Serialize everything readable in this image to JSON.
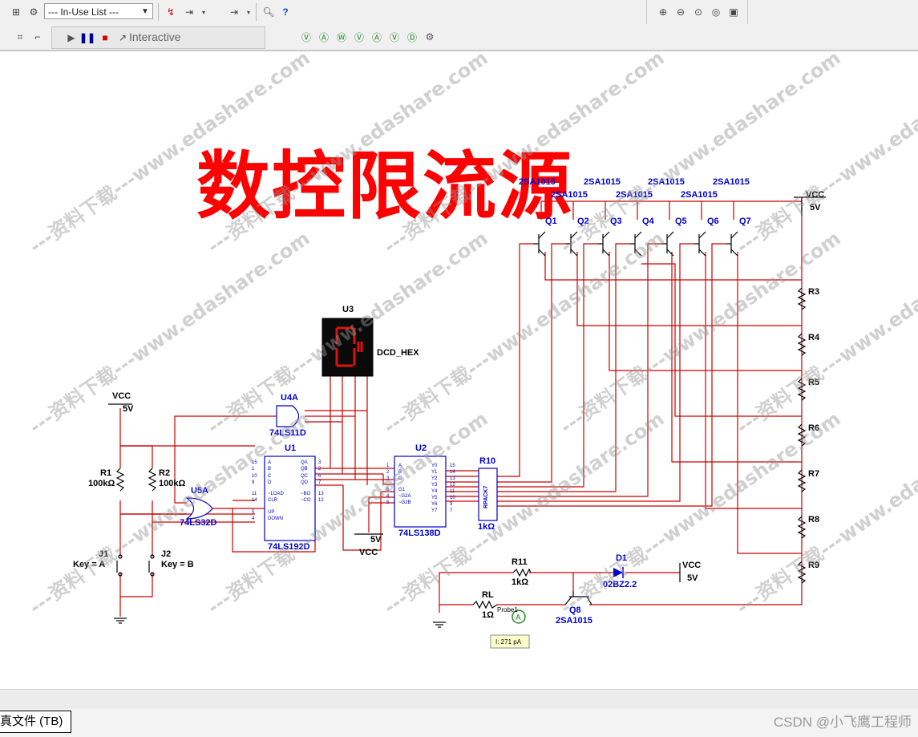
{
  "toolbar": {
    "in_use_list": "--- In-Use List ---",
    "simulate_mode": "Interactive",
    "left_icons": [
      "component-icon",
      "wire-icon"
    ],
    "place_icons": [
      "probe-icon",
      "place-icon",
      "place2-icon"
    ],
    "help_icons": [
      "find-icon",
      "help-icon"
    ],
    "zoom_icons": [
      "zoom-in-icon",
      "zoom-out-icon",
      "zoom-area-icon",
      "zoom-fit-icon",
      "full-screen-icon"
    ],
    "sim_icons": [
      "run-icon",
      "pause-icon",
      "stop-icon"
    ],
    "probe_icons": [
      "voltage-probe-icon",
      "ampere-probe-icon",
      "power-probe-icon",
      "differential-probe-icon",
      "current-probe-icon",
      "reference-probe-icon",
      "digital-probe-icon",
      "settings-icon"
    ]
  },
  "schematic": {
    "title": "数控限流源",
    "watermark": "---资料下载---www.edashare.com",
    "components": {
      "u3": "U3",
      "u3_type": "DCD_HEX",
      "u4a": "U4A",
      "u4a_type": "74LS11D",
      "u1": "U1",
      "u1_type": "74LS192D",
      "u2": "U2",
      "u2_type": "74LS138D",
      "u5a": "U5A",
      "u5a_type": "74LS32D",
      "r10": "R10",
      "r10_value": "1kΩ",
      "r10_pack": "RPACK7",
      "r1": "R1",
      "r1_value": "100kΩ",
      "r2": "R2",
      "r2_value": "100kΩ",
      "j1": "J1",
      "j1_key": "Key = A",
      "j2": "J2",
      "j2_key": "Key = B",
      "vcc_left": "VCC",
      "vcc_left_value": "5V",
      "vcc_mid": "VCC",
      "vcc_mid_value": "5V",
      "vcc_right": "VCC",
      "vcc_right_value": "5V",
      "vcc_d1": "VCC",
      "vcc_d1_value": "5V",
      "r11": "R11",
      "r11_value": "1kΩ",
      "d1": "D1",
      "d1_type": "02BZ2.2",
      "rl": "RL",
      "rl_value": "1Ω",
      "q8": "Q8",
      "q8_type": "2SA1015",
      "probe": "I: 271 pA",
      "probe_ref": "Probe1",
      "transistors": [
        "Q1",
        "Q2",
        "Q3",
        "Q4",
        "Q5",
        "Q6",
        "Q7"
      ],
      "transistor_types_top": [
        "2SA1015",
        "2SA1015",
        "2SA1015",
        "2SA1015"
      ],
      "transistor_types_bottom": [
        "2SA1015",
        "2SA1015",
        "2SA1015"
      ],
      "resistors_right": [
        "R3",
        "R4",
        "R5",
        "R6",
        "R7",
        "R8",
        "R9"
      ],
      "u1_pins_left": [
        "A",
        "B",
        "C",
        "D",
        "~LOAD",
        "CLR",
        "UP",
        "DOWN"
      ],
      "u1_pins_right": [
        "QA",
        "QB",
        "QC",
        "QD",
        "~BO",
        "~CO"
      ],
      "u1_pin_nums_left": [
        "15",
        "1",
        "10",
        "9",
        "11",
        "14",
        "5",
        "4"
      ],
      "u1_pin_nums_right": [
        "3",
        "2",
        "6",
        "7",
        "13",
        "12"
      ],
      "u2_pins_left": [
        "A",
        "B",
        "C",
        "G1",
        "~G2A",
        "~G2B"
      ],
      "u2_pins_right": [
        "Y0",
        "Y1",
        "Y2",
        "Y3",
        "Y4",
        "Y5",
        "Y6",
        "Y7"
      ],
      "u2_pin_nums_left": [
        "1",
        "2",
        "3",
        "6",
        "4",
        "5"
      ],
      "u2_pin_nums_right": [
        "15",
        "14",
        "13",
        "12",
        "11",
        "10",
        "9",
        "7"
      ]
    }
  },
  "status": {
    "tab_label": "真文件 (TB)",
    "credit": "CSDN @小飞鹰工程师"
  },
  "colors": {
    "wire": "#cc0000",
    "component": "#0000cc",
    "title": "#ff0000",
    "label": "#000000"
  }
}
